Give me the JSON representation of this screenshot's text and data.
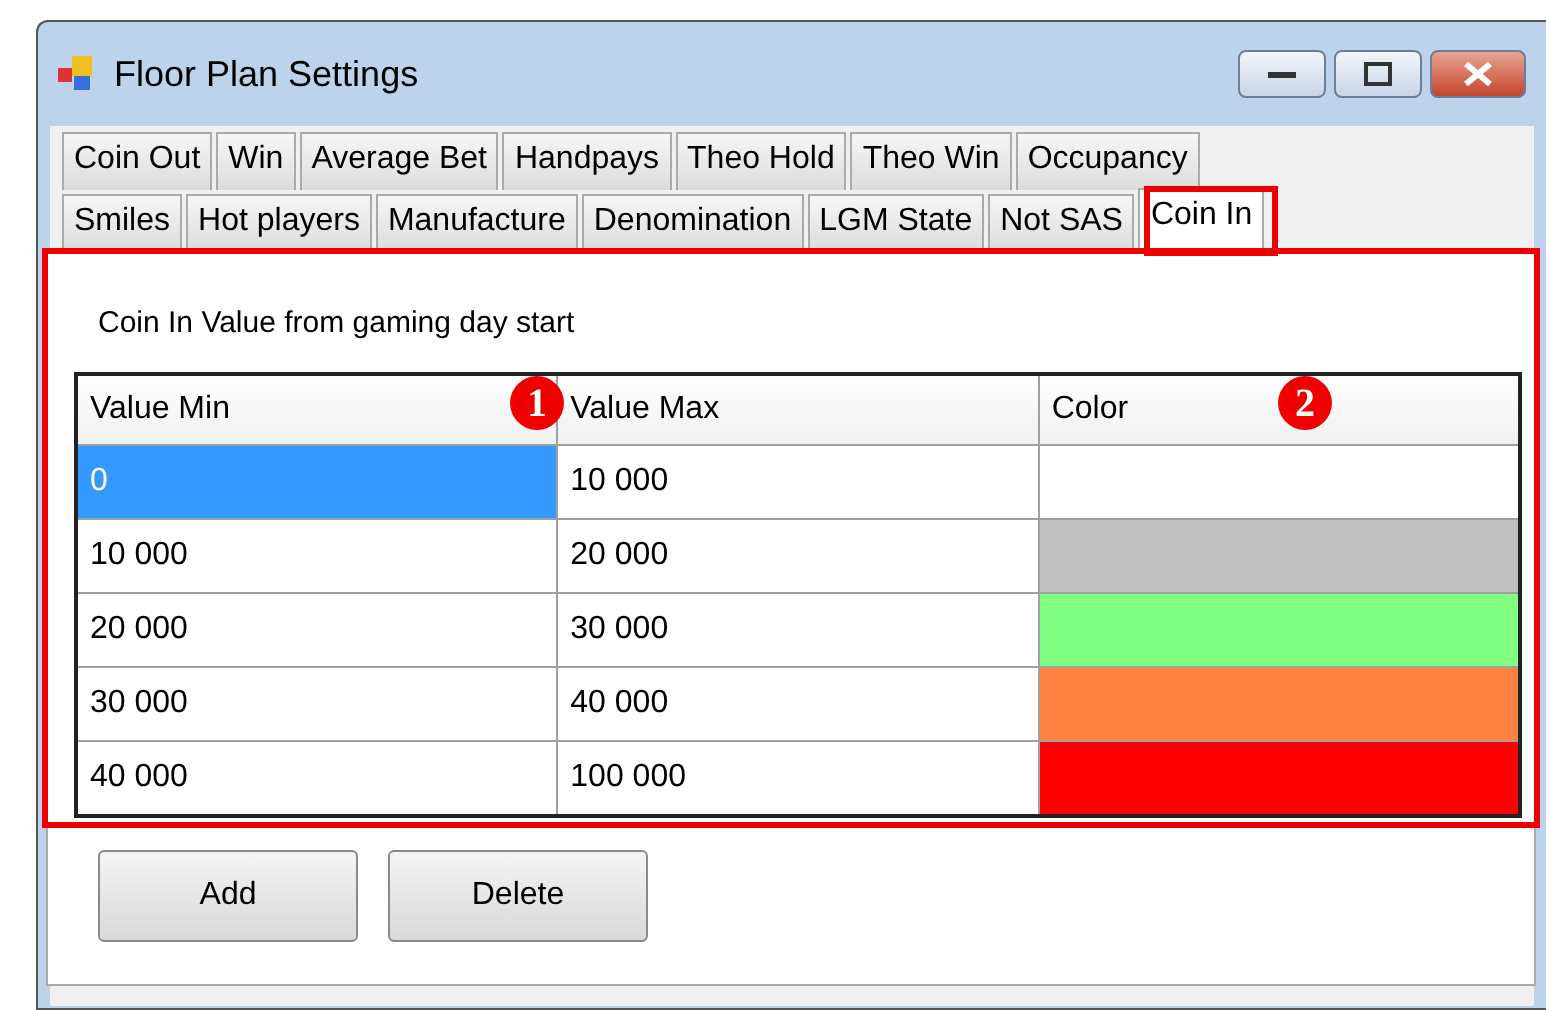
{
  "window": {
    "title": "Floor Plan Settings"
  },
  "tab_rows": [
    [
      {
        "label": "Coin Out",
        "selected": false
      },
      {
        "label": "Win",
        "selected": false
      },
      {
        "label": "Average Bet",
        "selected": false
      },
      {
        "label": "Handpays",
        "selected": false
      },
      {
        "label": "Theo Hold",
        "selected": false
      },
      {
        "label": "Theo Win",
        "selected": false
      },
      {
        "label": "Occupancy",
        "selected": false
      }
    ],
    [
      {
        "label": "Smiles",
        "selected": false
      },
      {
        "label": "Hot players",
        "selected": false
      },
      {
        "label": "Manufacture",
        "selected": false
      },
      {
        "label": "Denomination",
        "selected": false
      },
      {
        "label": "LGM State",
        "selected": false
      },
      {
        "label": "Not SAS",
        "selected": false
      },
      {
        "label": "Coin In",
        "selected": true
      }
    ]
  ],
  "panel": {
    "caption": "Coin In Value from gaming day start",
    "table": {
      "columns": [
        "Value Min",
        "Value Max",
        "Color"
      ],
      "rows": [
        {
          "min": "0",
          "max": "10 000",
          "color": "#ffffff",
          "selected": true
        },
        {
          "min": "10 000",
          "max": "20 000",
          "color": "#c0c0c0",
          "selected": false
        },
        {
          "min": "20 000",
          "max": "30 000",
          "color": "#80ff80",
          "selected": false
        },
        {
          "min": "30 000",
          "max": "40 000",
          "color": "#ff8040",
          "selected": false
        },
        {
          "min": "40 000",
          "max": "100 000",
          "color": "#ff0000",
          "selected": false
        }
      ]
    },
    "buttons": [
      "Add",
      "Delete"
    ]
  },
  "callouts": [
    "1",
    "2"
  ]
}
